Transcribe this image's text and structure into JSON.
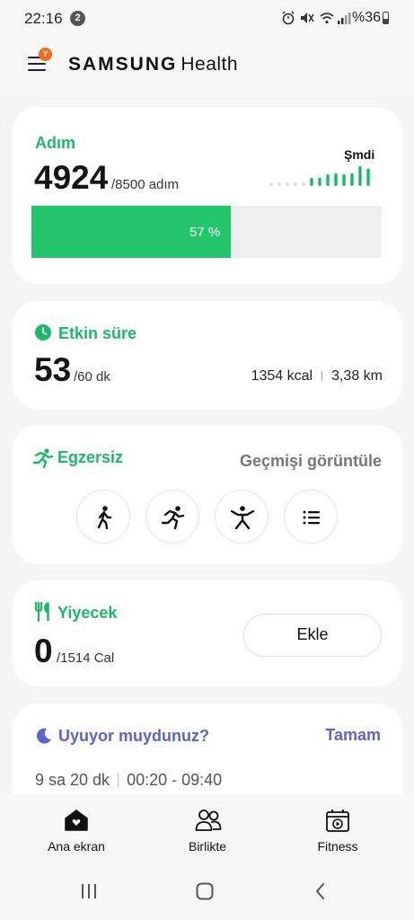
{
  "status_bar": {
    "time": "22:16",
    "notification_count": "2",
    "battery": "%36",
    "icons": [
      "alarm-icon",
      "mute-icon",
      "wifi-icon",
      "signal-icon",
      "battery-icon"
    ]
  },
  "app": {
    "brand_main": "SAMSUNG",
    "brand_sub": "Health",
    "menu_badge": "Y",
    "accent_color": "#1bb86a",
    "badge_color": "#f06a1d"
  },
  "steps": {
    "title": "Adım",
    "value": "4924",
    "goal": "/8500 adım",
    "progress_label": "57 %",
    "progress_fraction": 0.57,
    "now_label": "Şmdi",
    "mini_chart_values": [
      0.15,
      0.15,
      0.15,
      0.15,
      0.15,
      0.35,
      0.35,
      0.5,
      0.55,
      0.5,
      0.55,
      0.85,
      0.75
    ]
  },
  "active_time": {
    "title": "Etkin süre",
    "value": "53",
    "goal": "/60 dk",
    "calories": "1354 kcal",
    "distance": "3,38 km"
  },
  "exercise": {
    "title": "Egzersiz",
    "history_link": "Geçmişi görüntüle",
    "buttons": [
      "walking-icon",
      "running-icon",
      "workout-icon",
      "list-icon"
    ]
  },
  "food": {
    "title": "Yiyecek",
    "value": "0",
    "goal": "/1514 Cal",
    "add_label": "Ekle"
  },
  "sleep": {
    "title": "Uyuyor muydunuz?",
    "ok_label": "Tamam",
    "duration": "9 sa 20 dk",
    "range": "00:20 - 09:40",
    "color": "#5b63cf"
  },
  "bottom_nav": [
    {
      "label": "Ana ekran",
      "icon": "home-icon"
    },
    {
      "label": "Birlikte",
      "icon": "people-icon"
    },
    {
      "label": "Fitness",
      "icon": "fitness-icon"
    }
  ],
  "system_nav": [
    "recents-icon",
    "home-button-icon",
    "back-icon"
  ]
}
